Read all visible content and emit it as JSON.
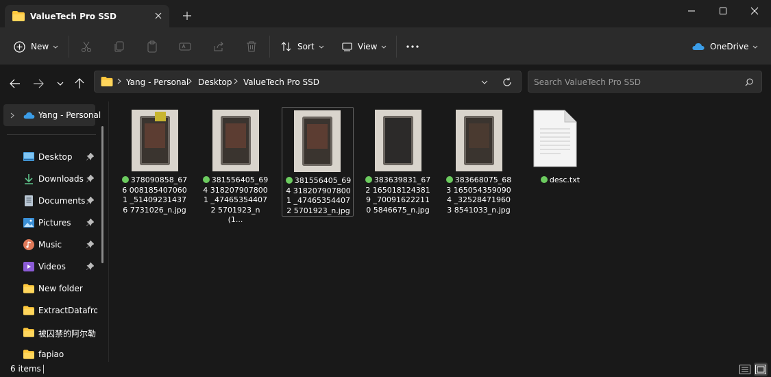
{
  "window": {
    "title": "ValueTech Pro SSD"
  },
  "toolbar": {
    "new_label": "New",
    "sort_label": "Sort",
    "view_label": "View",
    "account_label": "OneDrive"
  },
  "breadcrumb": [
    "Yang - Personal",
    "Desktop",
    "ValueTech Pro SSD"
  ],
  "search": {
    "placeholder": "Search ValueTech Pro SSD"
  },
  "sidebar": {
    "onedrive_label": "Yang - Personal",
    "items": [
      {
        "label": "Desktop",
        "icon": "desktop-icon",
        "pinned": true
      },
      {
        "label": "Downloads",
        "icon": "download-icon",
        "pinned": true
      },
      {
        "label": "Documents",
        "icon": "documents-icon",
        "pinned": true
      },
      {
        "label": "Pictures",
        "icon": "pictures-icon",
        "pinned": true
      },
      {
        "label": "Music",
        "icon": "music-icon",
        "pinned": true
      },
      {
        "label": "Videos",
        "icon": "videos-icon",
        "pinned": true
      },
      {
        "label": "New folder",
        "icon": "folder-icon",
        "pinned": false
      },
      {
        "label": "ExtractDatafrom",
        "icon": "folder-icon",
        "pinned": false
      },
      {
        "label": "被囚禁的阿尔勒",
        "icon": "folder-icon",
        "pinned": false
      },
      {
        "label": "fapiao",
        "icon": "folder-icon",
        "pinned": false
      }
    ]
  },
  "files": [
    {
      "name": "378090858_6760081854070601_5140923143767731026_n.jpg",
      "display": "378090858_676 0081854070601 _514092314376 7731026_n.jpg",
      "type": "image",
      "selected": false,
      "synced": true
    },
    {
      "name": "381556405_6943182079078001_4746535440725701923_n (1).jpg",
      "display": "381556405_694 3182079078001 _474653544072 5701923_n (1...",
      "type": "image",
      "selected": false,
      "synced": true
    },
    {
      "name": "381556405_6943182079078001_4746535440725701923_n.jpg",
      "display": "381556405_694 3182079078001 _474653544072 5701923_n.jpg",
      "type": "image",
      "selected": true,
      "synced": true
    },
    {
      "name": "383639831_6721650181243819_7009162221105846675_n.jpg",
      "display": "383639831_672 1650181243819 _700916222110 5846675_n.jpg",
      "type": "image",
      "selected": false,
      "synced": true
    },
    {
      "name": "383668075_6831650543590904_3252847196038541033_n.jpg",
      "display": "383668075_683 1650543590904 _325284719603 8541033_n.jpg",
      "type": "image",
      "selected": false,
      "synced": true
    },
    {
      "name": "desc.txt",
      "display": "desc.txt",
      "type": "text",
      "selected": false,
      "synced": true
    }
  ],
  "status": {
    "item_count": "6 items"
  },
  "colors": {
    "accent": "#ffc83d",
    "sync_ok": "#6ccb5f",
    "onedrive": "#3b9de8"
  }
}
